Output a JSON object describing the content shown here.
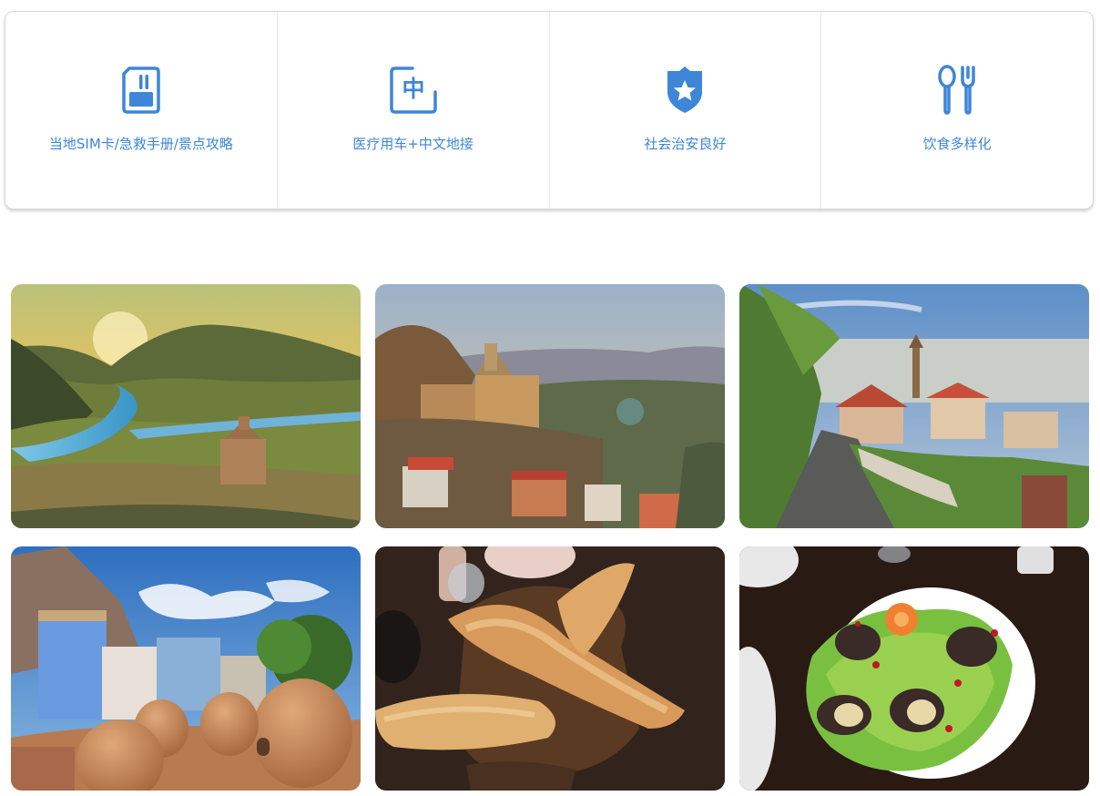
{
  "features": [
    {
      "icon": "sim-card-icon",
      "label": "当地SIM卡/急救手册/景点攻略"
    },
    {
      "icon": "chinese-character-icon",
      "label": "医疗用车+中文地接",
      "glyph": "中"
    },
    {
      "icon": "shield-star-icon",
      "label": "社会治安良好"
    },
    {
      "icon": "spoon-fork-icon",
      "label": "饮食多样化"
    }
  ],
  "accent_color": "#3d86d8",
  "gallery": [
    {
      "name": "mountain-river-monastery-photo"
    },
    {
      "name": "old-town-fortress-photo"
    },
    {
      "name": "hillside-village-street-photo"
    },
    {
      "name": "sulfur-baths-domes-photo"
    },
    {
      "name": "bread-basket-photo"
    },
    {
      "name": "eggplant-rolls-salad-photo"
    }
  ]
}
